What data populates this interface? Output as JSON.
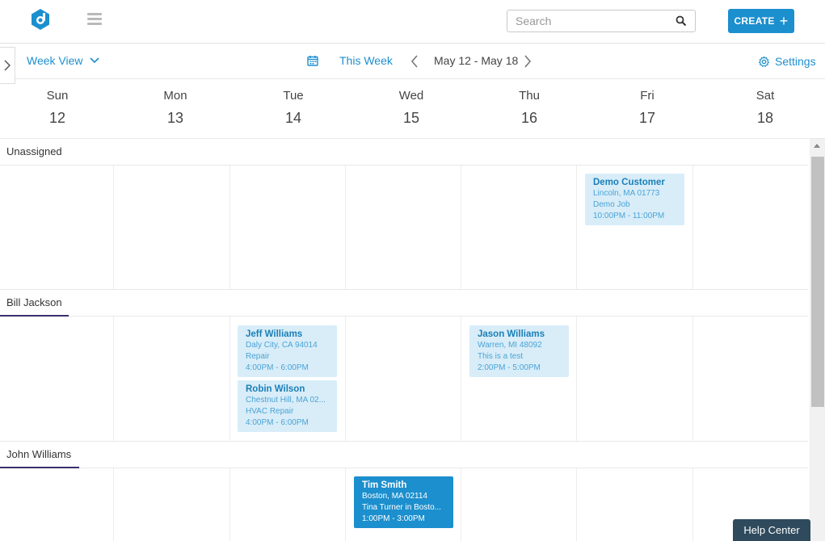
{
  "header": {
    "search_placeholder": "Search",
    "create_label": "CREATE",
    "create_icon": "+"
  },
  "toolbar": {
    "view_label": "Week View",
    "this_week_label": "This Week",
    "range_label": "May 12 - May 18",
    "settings_label": "Settings"
  },
  "days": [
    {
      "name": "Sun",
      "date": "12"
    },
    {
      "name": "Mon",
      "date": "13"
    },
    {
      "name": "Tue",
      "date": "14"
    },
    {
      "name": "Wed",
      "date": "15"
    },
    {
      "name": "Thu",
      "date": "16"
    },
    {
      "name": "Fri",
      "date": "17"
    },
    {
      "name": "Sat",
      "date": "18"
    }
  ],
  "groups": [
    {
      "name": "Unassigned"
    },
    {
      "name": "Bill Jackson"
    },
    {
      "name": "John Williams"
    }
  ],
  "events": {
    "demo": {
      "name": "Demo Customer",
      "location": "Lincoln, MA 01773",
      "job": "Demo Job",
      "time": "10:00PM - 11:00PM"
    },
    "jeff": {
      "name": "Jeff Williams",
      "location": "Daly City, CA 94014",
      "job": "Repair",
      "time": "4:00PM - 6:00PM"
    },
    "robin": {
      "name": "Robin Wilson",
      "location": "Chestnut Hill, MA 02...",
      "job": "HVAC Repair",
      "time": "4:00PM - 6:00PM"
    },
    "jason": {
      "name": "Jason Williams",
      "location": "Warren, MI 48092",
      "job": "This is a test",
      "time": "2:00PM - 5:00PM"
    },
    "tim": {
      "name": "Tim Smith",
      "location": "Boston, MA 02114",
      "job": "Tina Turner in Bosto...",
      "time": "1:00PM - 3:00PM"
    }
  },
  "help_label": "Help Center",
  "colors": {
    "accent": "#1c8fce",
    "event_light": "#d8edf8",
    "help_bg": "#2f4a5c"
  }
}
